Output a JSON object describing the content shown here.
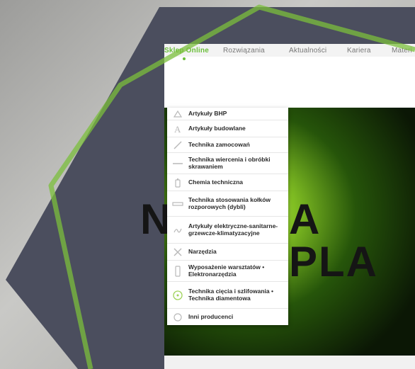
{
  "nav": {
    "items": [
      {
        "label": "Sklep Online",
        "active": true
      },
      {
        "label": "Rozwiązania",
        "active": false
      },
      {
        "label": "Aktualności",
        "active": false
      },
      {
        "label": "Kariera",
        "active": false
      },
      {
        "label": "Materi",
        "active": false
      }
    ]
  },
  "hero": {
    "left_text": "N",
    "right_text": "A PLA"
  },
  "menu": {
    "items": [
      {
        "label": "Artykuły BHP",
        "icon": "safety-icon"
      },
      {
        "label": "Artykuły budowlane",
        "icon": "building-icon"
      },
      {
        "label": "Technika zamocowań",
        "icon": "fastening-icon"
      },
      {
        "label": "Technika wiercenia i obróbki skrawaniem",
        "icon": "drill-icon"
      },
      {
        "label": "Chemia techniczna",
        "icon": "chemistry-icon"
      },
      {
        "label": "Technika stosowania kołków rozporowych (dybli)",
        "icon": "anchor-icon"
      },
      {
        "label": "Artykuły elektryczne-sanitarne-grzewcze-klimatyzacyjne",
        "icon": "electric-icon"
      },
      {
        "label": "Narzędzia",
        "icon": "tools-icon"
      },
      {
        "label": "Wyposażenie warsztatów • Elektronarzędzia",
        "icon": "workshop-icon"
      },
      {
        "label": "Technika cięcia i szlifowania • Technika diamentowa",
        "icon": "cutting-icon"
      },
      {
        "label": "Inni producenci",
        "icon": "other-icon"
      }
    ]
  },
  "colors": {
    "accent": "#6bbf3a",
    "frame_dark": "#4b4e5e",
    "frame_green": "#7bbf3c"
  }
}
